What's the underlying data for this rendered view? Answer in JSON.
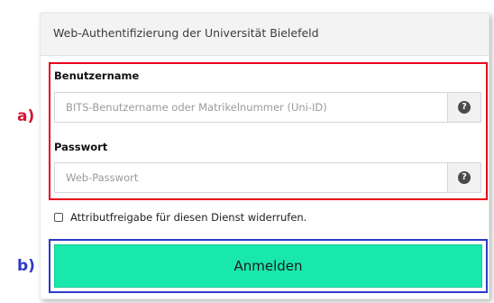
{
  "header": {
    "title": "Web-Authentifizierung der Universität Bielefeld"
  },
  "annotations": {
    "credentials_marker": "a)",
    "button_marker": "b)",
    "credentials_color": "#e8001c",
    "button_color": "#2d39c8"
  },
  "form": {
    "username": {
      "label": "Benutzername",
      "placeholder": "BITS-Benutzername oder Matrikelnummer (Uni-ID)",
      "value": "",
      "help_icon": "question-circle-icon"
    },
    "password": {
      "label": "Passwort",
      "placeholder": "Web-Passwort",
      "value": "",
      "help_icon": "question-circle-icon"
    },
    "revoke_consent": {
      "label": "Attributfreigabe für diesen Dienst widerrufen.",
      "checked": false
    },
    "submit_label": "Anmelden"
  },
  "colors": {
    "button_background": "#19e8ad",
    "header_background": "#f3f3f3"
  }
}
